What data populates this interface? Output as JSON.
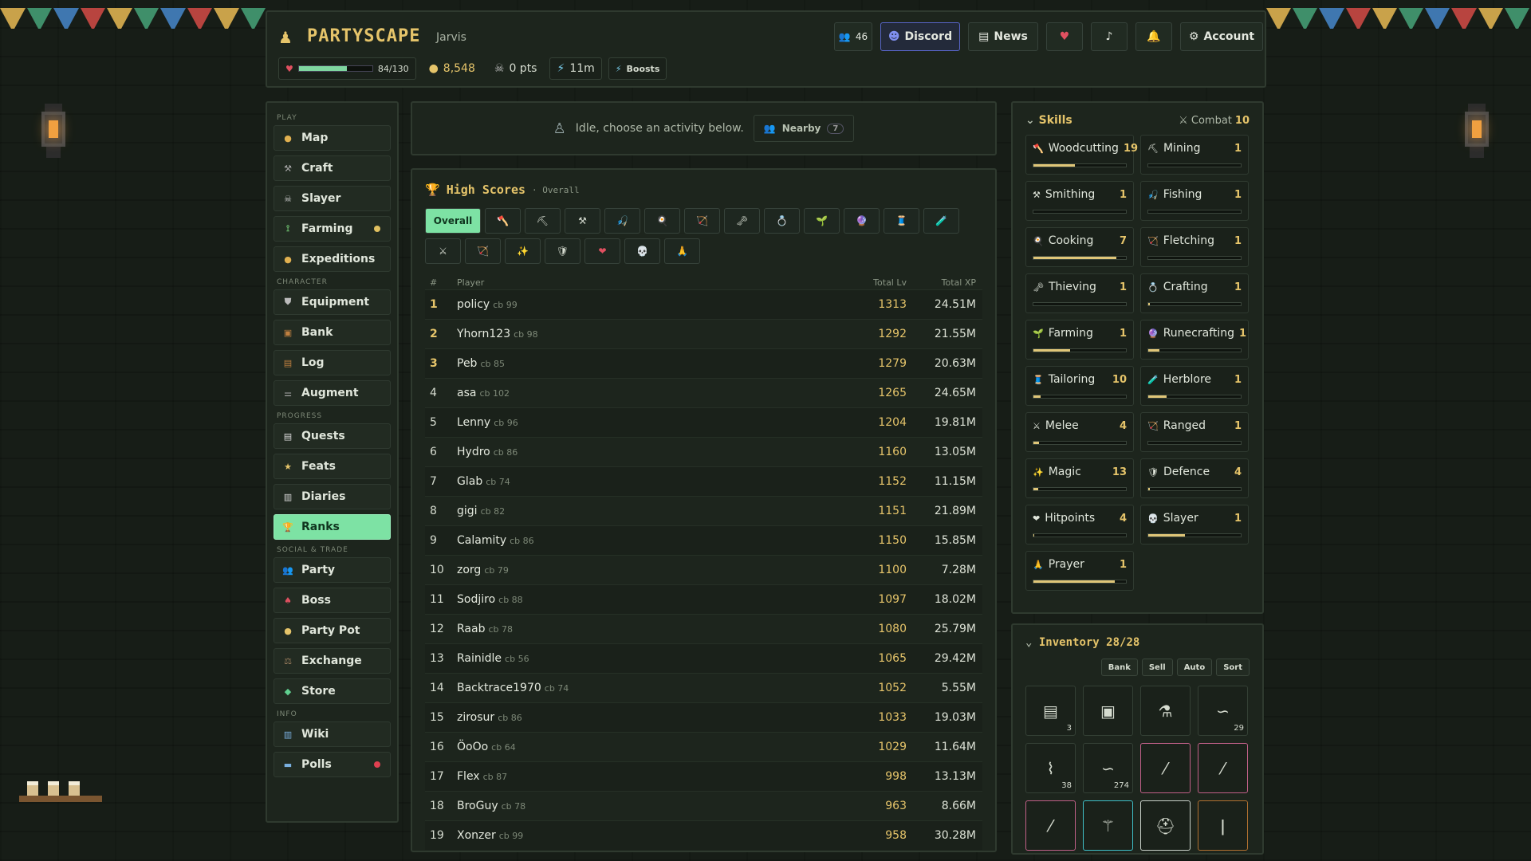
{
  "header": {
    "brand": "PARTYSCAPE",
    "username": "Jarvis",
    "online_count": "46",
    "discord_label": "Discord",
    "news_label": "News",
    "account_label": "Account",
    "hp_text": "84/130",
    "hp_fraction": 0.65,
    "gold": "8,548",
    "points": "0 pts",
    "time": "11m",
    "boosts_label": "Boosts"
  },
  "sidebar": {
    "sections": {
      "play": "PLAY",
      "character": "CHARACTER",
      "progress": "PROGRESS",
      "social": "SOCIAL & TRADE",
      "info": "INFO"
    },
    "play": [
      "Map",
      "Craft",
      "Slayer",
      "Farming",
      "Expeditions"
    ],
    "character": [
      "Equipment",
      "Bank",
      "Log",
      "Augment"
    ],
    "progress": [
      "Quests",
      "Feats",
      "Diaries",
      "Ranks"
    ],
    "social": [
      "Party",
      "Boss",
      "Party Pot",
      "Exchange",
      "Store"
    ],
    "info": [
      "Wiki",
      "Polls"
    ]
  },
  "status": {
    "idle_text": "Idle, choose an activity below.",
    "nearby_label": "Nearby",
    "nearby_count": "7"
  },
  "highscores": {
    "title": "High Scores",
    "subtitle": "· Overall",
    "overall_tab": "Overall",
    "columns": {
      "rank": "#",
      "player": "Player",
      "total_lv": "Total Lv",
      "total_xp": "Total XP"
    },
    "rows": [
      {
        "rank": "1",
        "name": "policy",
        "cb": "cb 99",
        "lv": "1313",
        "xp": "24.51M"
      },
      {
        "rank": "2",
        "name": "Yhorn123",
        "cb": "cb 98",
        "lv": "1292",
        "xp": "21.55M"
      },
      {
        "rank": "3",
        "name": "Peb",
        "cb": "cb 85",
        "lv": "1279",
        "xp": "20.63M"
      },
      {
        "rank": "4",
        "name": "asa",
        "cb": "cb 102",
        "lv": "1265",
        "xp": "24.65M"
      },
      {
        "rank": "5",
        "name": "Lenny",
        "cb": "cb 96",
        "lv": "1204",
        "xp": "19.81M"
      },
      {
        "rank": "6",
        "name": "Hydro",
        "cb": "cb 86",
        "lv": "1160",
        "xp": "13.05M"
      },
      {
        "rank": "7",
        "name": "Glab",
        "cb": "cb 74",
        "lv": "1152",
        "xp": "11.15M"
      },
      {
        "rank": "8",
        "name": "gigi",
        "cb": "cb 82",
        "lv": "1151",
        "xp": "21.89M"
      },
      {
        "rank": "9",
        "name": "Calamity",
        "cb": "cb 86",
        "lv": "1150",
        "xp": "15.85M"
      },
      {
        "rank": "10",
        "name": "zorg",
        "cb": "cb 79",
        "lv": "1100",
        "xp": "7.28M"
      },
      {
        "rank": "11",
        "name": "Sodjiro",
        "cb": "cb 88",
        "lv": "1097",
        "xp": "18.02M"
      },
      {
        "rank": "12",
        "name": "Raab",
        "cb": "cb 78",
        "lv": "1080",
        "xp": "25.79M"
      },
      {
        "rank": "13",
        "name": "Rainidle",
        "cb": "cb 56",
        "lv": "1065",
        "xp": "29.42M"
      },
      {
        "rank": "14",
        "name": "Backtrace1970",
        "cb": "cb 74",
        "lv": "1052",
        "xp": "5.55M"
      },
      {
        "rank": "15",
        "name": "zirosur",
        "cb": "cb 86",
        "lv": "1033",
        "xp": "19.03M"
      },
      {
        "rank": "16",
        "name": "ÖoOo",
        "cb": "cb 64",
        "lv": "1029",
        "xp": "11.64M"
      },
      {
        "rank": "17",
        "name": "Flex",
        "cb": "cb 87",
        "lv": "998",
        "xp": "13.13M"
      },
      {
        "rank": "18",
        "name": "BroGuy",
        "cb": "cb 78",
        "lv": "963",
        "xp": "8.66M"
      },
      {
        "rank": "19",
        "name": "Xonzer",
        "cb": "cb 99",
        "lv": "958",
        "xp": "30.28M"
      }
    ]
  },
  "skills": {
    "title": "Skills",
    "combat_label": "Combat",
    "combat_level": "10",
    "list": [
      {
        "name": "Woodcutting",
        "level": "19",
        "progress": 0.45,
        "icon": "🪓"
      },
      {
        "name": "Mining",
        "level": "1",
        "progress": 0,
        "icon": "⛏"
      },
      {
        "name": "Smithing",
        "level": "1",
        "progress": 0,
        "icon": "⚒"
      },
      {
        "name": "Fishing",
        "level": "1",
        "progress": 0,
        "icon": "🎣"
      },
      {
        "name": "Cooking",
        "level": "7",
        "progress": 0.9,
        "icon": "🍳"
      },
      {
        "name": "Fletching",
        "level": "1",
        "progress": 0,
        "icon": "🏹"
      },
      {
        "name": "Thieving",
        "level": "1",
        "progress": 0,
        "icon": "🗝"
      },
      {
        "name": "Crafting",
        "level": "1",
        "progress": 0.02,
        "icon": "💍"
      },
      {
        "name": "Farming",
        "level": "1",
        "progress": 0.4,
        "icon": "🌱"
      },
      {
        "name": "Runecrafting",
        "level": "1",
        "progress": 0.12,
        "icon": "🔮"
      },
      {
        "name": "Tailoring",
        "level": "10",
        "progress": 0.08,
        "icon": "🧵"
      },
      {
        "name": "Herblore",
        "level": "1",
        "progress": 0.2,
        "icon": "🧪"
      },
      {
        "name": "Melee",
        "level": "4",
        "progress": 0.06,
        "icon": "⚔"
      },
      {
        "name": "Ranged",
        "level": "1",
        "progress": 0,
        "icon": "🏹"
      },
      {
        "name": "Magic",
        "level": "13",
        "progress": 0.05,
        "icon": "✨"
      },
      {
        "name": "Defence",
        "level": "4",
        "progress": 0.02,
        "icon": "🛡"
      },
      {
        "name": "Hitpoints",
        "level": "4",
        "progress": 0.01,
        "icon": "❤"
      },
      {
        "name": "Slayer",
        "level": "1",
        "progress": 0.4,
        "icon": "💀"
      },
      {
        "name": "Prayer",
        "level": "1",
        "progress": 0.88,
        "icon": "🙏"
      }
    ]
  },
  "inventory": {
    "title": "Inventory 28/28",
    "buttons": [
      "Bank",
      "Sell",
      "Auto",
      "Sort"
    ],
    "slots": [
      {
        "icon": "▤",
        "qty": "3",
        "border": ""
      },
      {
        "icon": "▣",
        "qty": "",
        "border": ""
      },
      {
        "icon": "⚗",
        "qty": "",
        "border": ""
      },
      {
        "icon": "∽",
        "qty": "29",
        "border": ""
      },
      {
        "icon": "⌇",
        "qty": "38",
        "border": ""
      },
      {
        "icon": "∽",
        "qty": "274",
        "border": ""
      },
      {
        "icon": "⁄",
        "qty": "",
        "border": "pink"
      },
      {
        "icon": "⁄",
        "qty": "",
        "border": "pink"
      },
      {
        "icon": "⁄",
        "qty": "",
        "border": "pink"
      },
      {
        "icon": "⚚",
        "qty": "",
        "border": "cyan"
      },
      {
        "icon": "⛑",
        "qty": "",
        "border": "white"
      },
      {
        "icon": "ǀ",
        "qty": "",
        "border": "orange"
      }
    ]
  }
}
